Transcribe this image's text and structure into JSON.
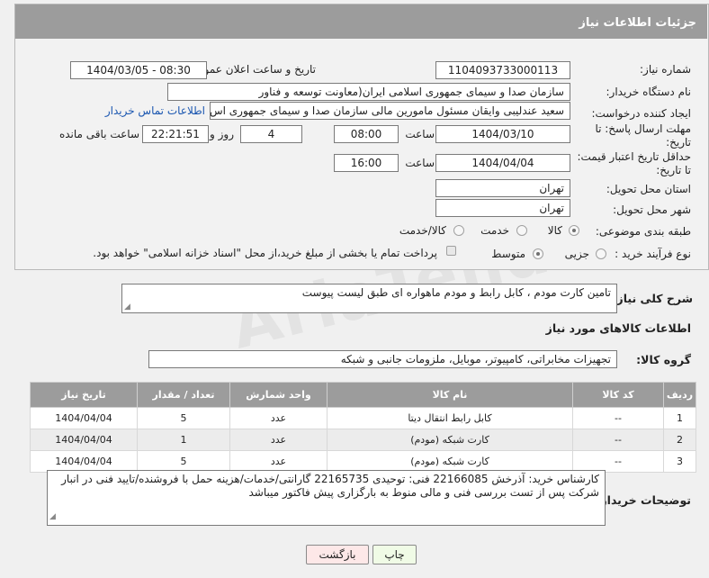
{
  "header": {
    "title": "جزئیات اطلاعات نیاز"
  },
  "fields": {
    "need_number": {
      "label": "شماره نیاز:",
      "value": "1104093733000113"
    },
    "announce_datetime": {
      "label": "تاریخ و ساعت اعلان عمومی:",
      "value": "1404/03/05 - 08:30"
    },
    "buyer_org": {
      "label": "نام دستگاه خریدار:",
      "value": "سازمان صدا و سیمای جمهوری اسلامی ایران(معاونت توسعه و فناور"
    },
    "creator": {
      "label": "ایجاد کننده درخواست:",
      "value": "سعید عندلیبی وایقان مسئول مامورین مالی  سازمان صدا و سیمای جمهوری اس",
      "contact_link": "اطلاعات تماس خریدار"
    },
    "reply_deadline": {
      "label": "مهلت ارسال پاسخ: تا تاریخ:",
      "date": "1404/03/10",
      "time_label": "ساعت",
      "time": "08:00",
      "days": "4",
      "days_label": "روز و",
      "remaining": "22:21:51",
      "remaining_label": "ساعت باقی مانده"
    },
    "price_validity": {
      "label": "حداقل تاریخ اعتبار قیمت: تا تاریخ:",
      "date": "1404/04/04",
      "time_label": "ساعت",
      "time": "16:00"
    },
    "delivery_province": {
      "label": "استان محل تحویل:",
      "value": "تهران"
    },
    "delivery_city": {
      "label": "شهر محل تحویل:",
      "value": "تهران"
    },
    "category": {
      "label": "طبقه بندی موضوعی:",
      "options": [
        "کالا",
        "خدمت",
        "کالا/خدمت"
      ],
      "selected": "کالا"
    },
    "purchase_type": {
      "label": "نوع فرآیند خرید :",
      "options": [
        "جزیی",
        "متوسط"
      ],
      "selected": "متوسط",
      "payment_note": "پرداخت تمام یا بخشی از مبلغ خرید،از محل \"اسناد خزانه اسلامی\" خواهد بود."
    }
  },
  "description": {
    "label": "شرح کلی نیاز:",
    "value": "تامین کارت مودم ، کابل رابط و مودم ماهواره ای طبق لیست پیوست"
  },
  "goods_section": {
    "title": "اطلاعات کالاهای مورد نیاز",
    "group_label": "گروه کالا:",
    "group_value": "تجهیزات مخابراتی، کامپیوتر، موبایل، ملزومات جانبی و شبکه"
  },
  "table": {
    "headers": [
      "ردیف",
      "کد کالا",
      "نام کالا",
      "واحد شمارش",
      "تعداد / مقدار",
      "تاریخ نیاز"
    ],
    "rows": [
      [
        "1",
        "--",
        "کابل رابط انتقال دیتا",
        "عدد",
        "5",
        "1404/04/04"
      ],
      [
        "2",
        "--",
        "کارت شبکه (مودم)",
        "عدد",
        "1",
        "1404/04/04"
      ],
      [
        "3",
        "--",
        "کارت شبکه (مودم)",
        "عدد",
        "5",
        "1404/04/04"
      ]
    ]
  },
  "buyer_notes": {
    "label": "توضیحات خریدار:",
    "value": "کارشناس خرید: آذرخش  22166085   فنی: توحیدی 22165735 گارانتی/خدمات/هزینه حمل با فروشنده/تایید فنی در انبار شرکت پس از تست بررسی فنی و مالی منوط به بارگزاری پیش فاکتور میباشد"
  },
  "buttons": {
    "print": "چاپ",
    "back": "بازگشت"
  },
  "watermark": "AriaTender.net"
}
